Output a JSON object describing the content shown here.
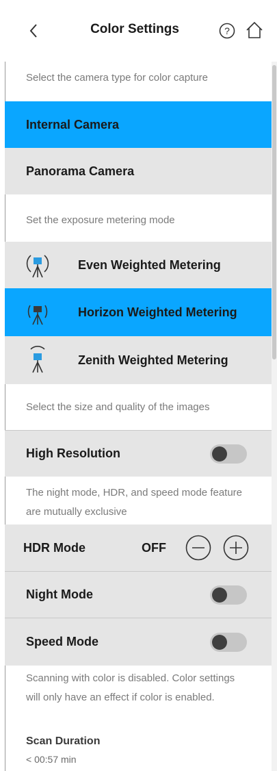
{
  "header": {
    "title": "Color Settings"
  },
  "camera": {
    "hint": "Select the camera type for color capture",
    "options": [
      {
        "label": "Internal Camera",
        "selected": true
      },
      {
        "label": "Panorama Camera",
        "selected": false
      }
    ]
  },
  "metering": {
    "hint": "Set the exposure metering mode",
    "options": [
      {
        "label": "Even Weighted Metering",
        "icon": "even-metering-tripod-icon",
        "selected": false
      },
      {
        "label": "Horizon Weighted Metering",
        "icon": "horizon-metering-tripod-icon",
        "selected": true
      },
      {
        "label": "Zenith Weighted Metering",
        "icon": "zenith-metering-tripod-icon",
        "selected": false
      }
    ]
  },
  "image_quality": {
    "hint": "Select the size and quality of the images",
    "high_resolution": {
      "label": "High Resolution",
      "on": false
    }
  },
  "modes": {
    "note": "The night mode, HDR, and speed mode feature are mutually exclusive",
    "hdr": {
      "label": "HDR Mode",
      "value": "OFF"
    },
    "night": {
      "label": "Night Mode",
      "on": false
    },
    "speed": {
      "label": "Speed Mode",
      "on": false
    }
  },
  "footer": {
    "note": "Scanning with color is disabled. Color settings will only have an effect if color is enabled.",
    "scan_duration_label": "Scan Duration",
    "scan_duration_value": "< 00:57 min"
  },
  "colors": {
    "accent": "#0aa6ff",
    "row_gray": "#e5e5e5",
    "toggle_off_track": "#c6c6c6",
    "toggle_off_knob": "#3f3f3f"
  }
}
